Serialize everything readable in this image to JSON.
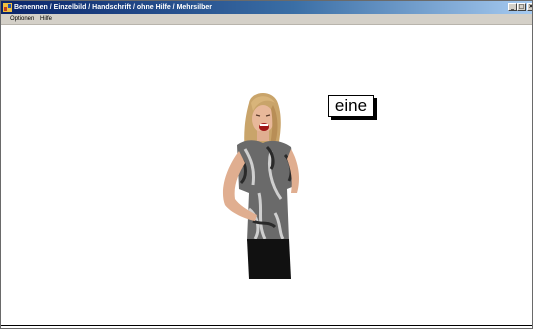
{
  "window": {
    "title": "Benennen / Einzelbild / Handschrift / ohne Hilfe / Mehrsilber",
    "controls": {
      "minimize": "_",
      "maximize": "□",
      "close": "×"
    }
  },
  "menu": {
    "items": [
      {
        "label": "Optionen"
      },
      {
        "label": "Hilfe"
      }
    ]
  },
  "content": {
    "image": {
      "icon": "woman-laughing-photo"
    },
    "word_card": {
      "text": "eine"
    }
  },
  "colors": {
    "titlebar_start": "#0a246a",
    "titlebar_end": "#a6caf0",
    "menubar": "#d4d0c8"
  }
}
